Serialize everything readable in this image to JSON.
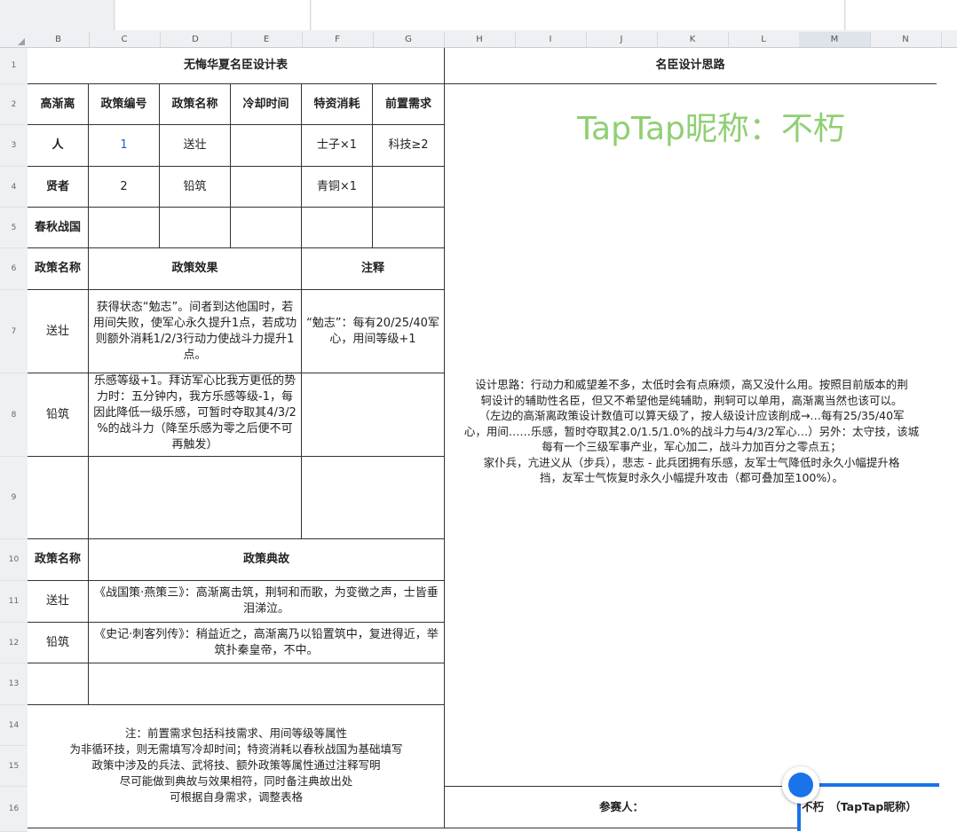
{
  "columns": [
    "B",
    "C",
    "D",
    "E",
    "F",
    "G",
    "H",
    "I",
    "J",
    "K",
    "L",
    "M",
    "N"
  ],
  "rows": [
    "1",
    "2",
    "3",
    "4",
    "5",
    "6",
    "7",
    "8",
    "9",
    "10",
    "11",
    "12",
    "13",
    "14",
    "15",
    "16"
  ],
  "table_title": "无悔华夏名臣设计表",
  "design_title": "名臣设计思路",
  "header": {
    "name": "高渐离",
    "policy_no": "政策编号",
    "policy_name": "政策名称",
    "cooldown": "冷却时间",
    "cost": "特资消耗",
    "prereq": "前置需求"
  },
  "policies": [
    {
      "era": "人",
      "no": "1",
      "name": "送壮",
      "cooldown": "",
      "cost": "士子×1",
      "prereq": "科技≥2"
    },
    {
      "era": "贤者",
      "no": "2",
      "name": "铅筑",
      "cooldown": "",
      "cost": "青铜×1",
      "prereq": ""
    },
    {
      "era": "春秋战国",
      "no": "",
      "name": "",
      "cooldown": "",
      "cost": "",
      "prereq": ""
    }
  ],
  "effects_header": {
    "name": "政策名称",
    "effect": "政策效果",
    "note": "注释"
  },
  "effects": [
    {
      "name": "送壮",
      "effect": "获得状态“勉志”。间者到达他国时，若用间失败，使军心永久提升1点，若成功则额外消耗1/2/3行动力使战斗力提升1点。",
      "note": "“勉志”：每有20/25/40军心，用间等级+1"
    },
    {
      "name": "铅筑",
      "effect": "乐感等级+1。拜访军心比我方更低的势力时：五分钟内，我方乐感等级-1，每因此降低一级乐感，可暂时夺取其4/3/2 %的战斗力（降至乐感为零之后便不可再触发）",
      "note": ""
    }
  ],
  "story_header": {
    "name": "政策名称",
    "story": "政策典故"
  },
  "stories": [
    {
      "name": "送壮",
      "story": "《战国策·燕策三》：高渐离击筑，荆轲和而歌，为变徵之声，士皆垂泪涕泣。"
    },
    {
      "name": "铅筑",
      "story": "《史记·刺客列传》：稍益近之，高渐离乃以铅置筑中，复进得近，举筑扑秦皇帝，不中。"
    }
  ],
  "notes": [
    "注：前置需求包括科技需求、用间等级等属性",
    "为非循环技，则无需填写冷却时间；特资消耗以春秋战国为基础填写",
    "政策中涉及的兵法、武将技、额外政策等属性通过注释写明",
    "尽可能做到典故与效果相符，同时备注典故出处",
    "可根据自身需求，调整表格"
  ],
  "watermark": "TapTap昵称：不朽",
  "design_text": [
    "设计思路：行动力和威望差不多，太低时会有点麻烦，高又没什么用。按照目前版本的荆",
    "轲设计的辅助性名臣，但又不希望他是纯辅助，荆轲可以单用，高渐离当然也该可以。",
    "（左边的高渐离政策设计数值可以算天级了，按人级设计应该削成→…每有25/35/40军",
    "心，用间……乐感，暂时夺取其2.0/1.5/1.0%的战斗力与4/3/2军心…）另外：太守技，该城",
    "每有一个三级军事产业，军心加二，战斗力加百分之零点五；",
    "家仆兵，亢进义从（步兵），悲志 - 此兵团拥有乐感，友军士气降低时永久小幅提升格",
    "挡，友军士气恢复时永久小幅提升攻击（都可叠加至100%）。"
  ],
  "participant_label": "参赛人：",
  "participant_value": "不朽　（TapTap昵称）",
  "colors": {
    "watermark": "#8fcf73",
    "accent": "#1a73e8",
    "link_number": "#1a63c9"
  }
}
